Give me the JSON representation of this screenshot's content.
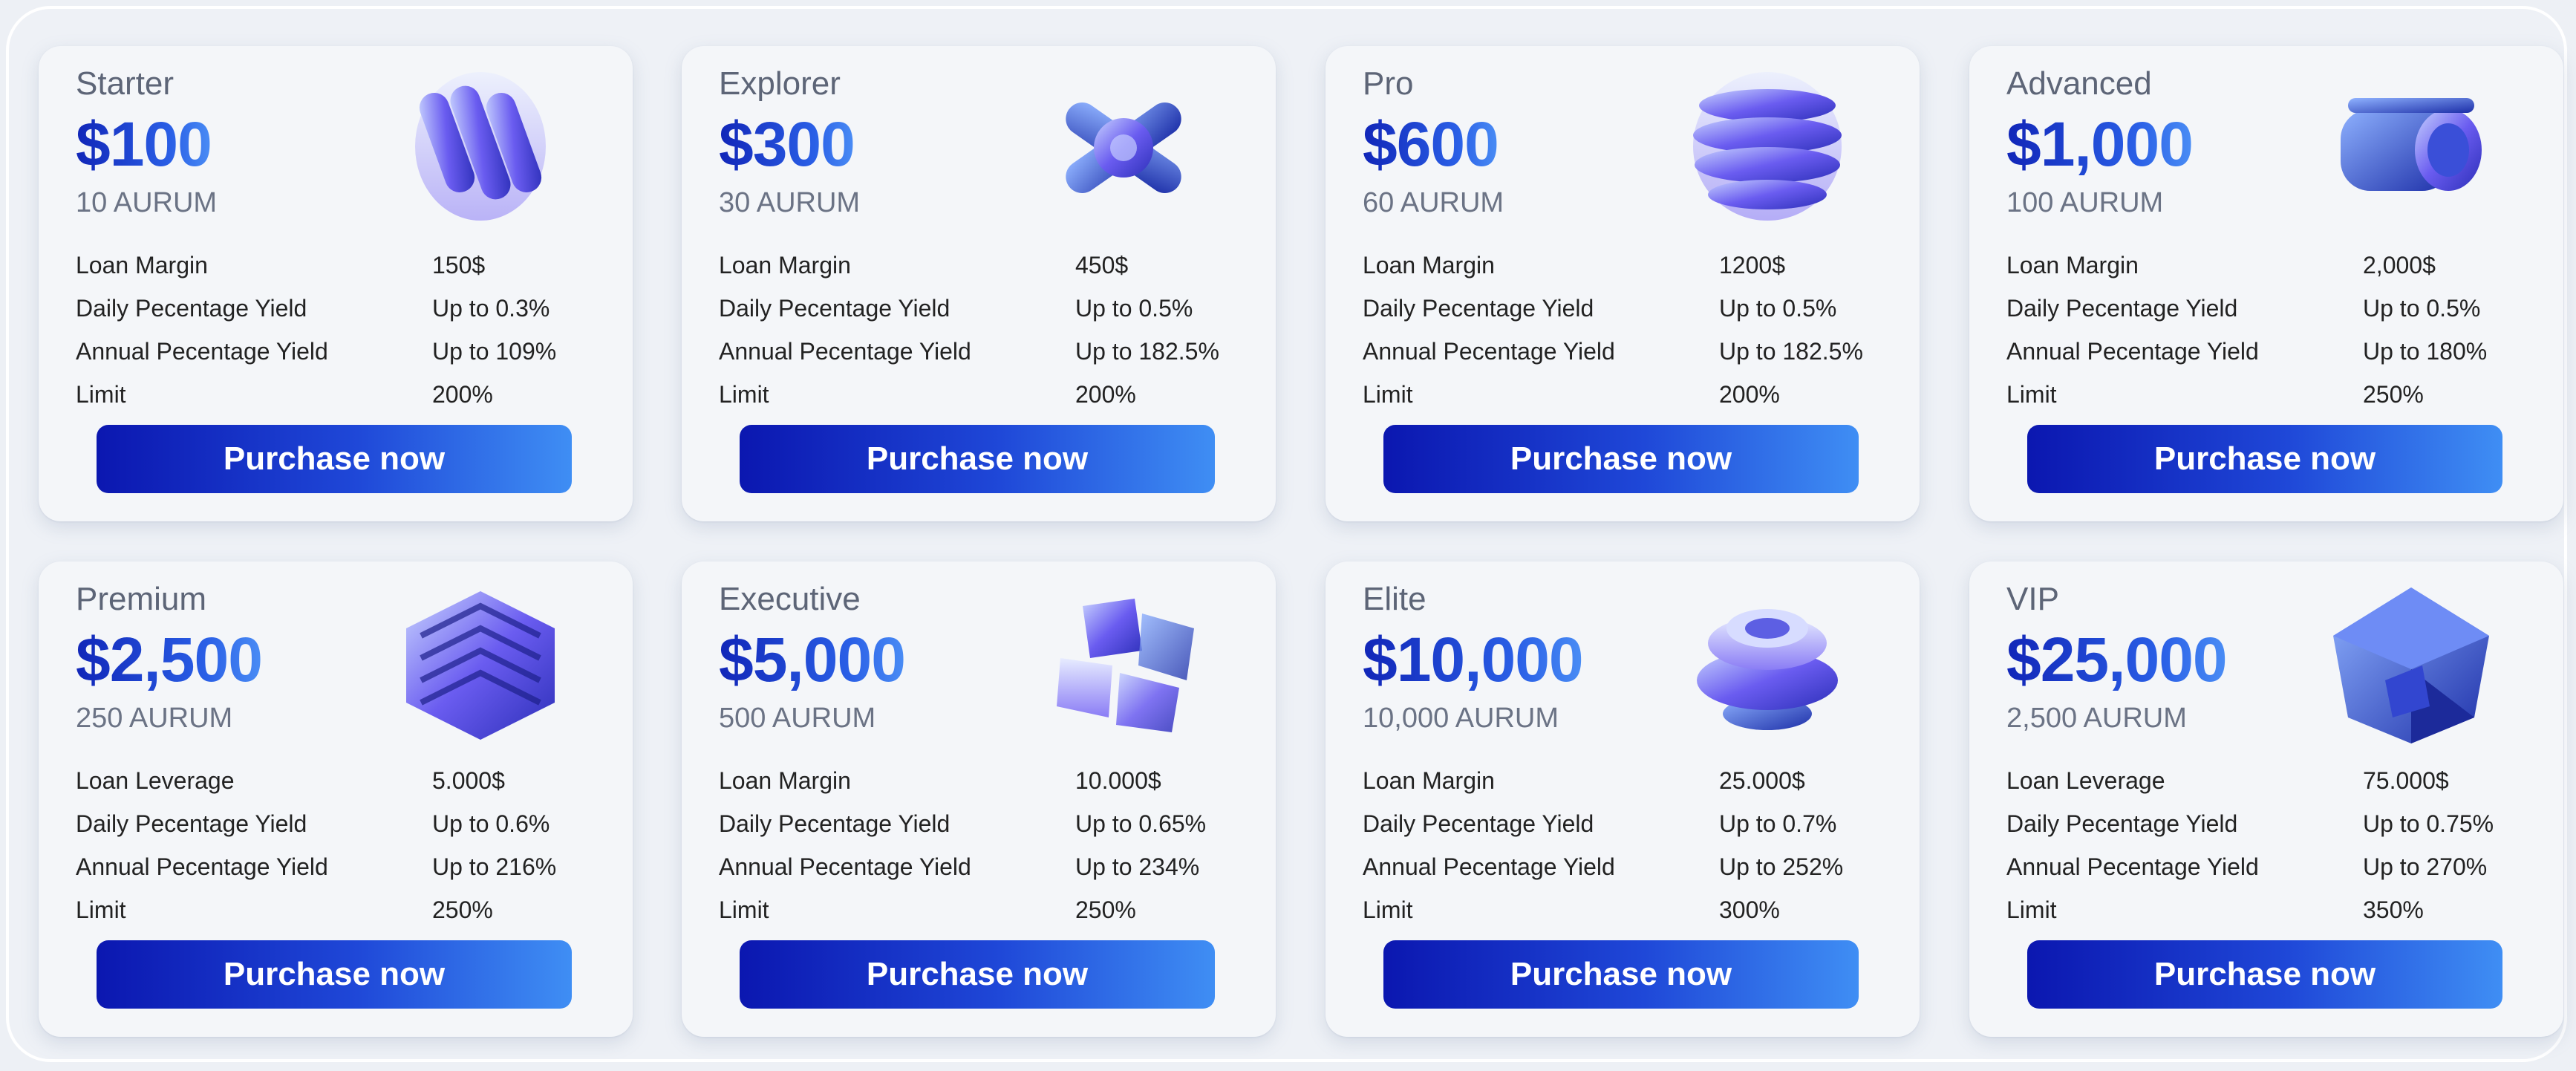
{
  "cards": [
    {
      "tier": "Starter",
      "price": "$100",
      "aurum": "10 AURUM",
      "rows": [
        {
          "k": "Loan Margin",
          "v": "150$"
        },
        {
          "k": "Daily Pecentage Yield",
          "v": "Up to 0.3%"
        },
        {
          "k": "Annual Pecentage Yield",
          "v": "Up to 109%"
        },
        {
          "k": "Limit",
          "v": "200%"
        }
      ],
      "button": "Purchase now",
      "art": "stacked-rings-icon"
    },
    {
      "tier": "Explorer",
      "price": "$300",
      "aurum": "30 AURUM",
      "rows": [
        {
          "k": "Loan Margin",
          "v": "450$"
        },
        {
          "k": "Daily Pecentage Yield",
          "v": "Up to 0.5%"
        },
        {
          "k": "Annual Pecentage Yield",
          "v": "Up to 182.5%"
        },
        {
          "k": "Limit",
          "v": "200%"
        }
      ],
      "button": "Purchase now",
      "art": "cross-connector-icon"
    },
    {
      "tier": "Pro",
      "price": "$600",
      "aurum": "60 AURUM",
      "rows": [
        {
          "k": "Loan Margin",
          "v": "1200$"
        },
        {
          "k": "Daily Pecentage Yield",
          "v": "Up to 0.5%"
        },
        {
          "k": "Annual Pecentage Yield",
          "v": "Up to 182.5%"
        },
        {
          "k": "Limit",
          "v": "200%"
        }
      ],
      "button": "Purchase now",
      "art": "spiral-sphere-icon"
    },
    {
      "tier": "Advanced",
      "price": "$1,000",
      "aurum": "100 AURUM",
      "rows": [
        {
          "k": "Loan Margin",
          "v": "2,000$"
        },
        {
          "k": "Daily Pecentage Yield",
          "v": "Up to 0.5%"
        },
        {
          "k": "Annual Pecentage Yield",
          "v": "Up to 180%"
        },
        {
          "k": "Limit",
          "v": "250%"
        }
      ],
      "button": "Purchase now",
      "art": "cylinder-icon"
    },
    {
      "tier": "Premium",
      "price": "$2,500",
      "aurum": "250 AURUM",
      "rows": [
        {
          "k": "Loan Leverage",
          "v": "5.000$"
        },
        {
          "k": "Daily Pecentage Yield",
          "v": "Up to 0.6%"
        },
        {
          "k": "Annual Pecentage Yield",
          "v": "Up to 216%"
        },
        {
          "k": "Limit",
          "v": "250%"
        }
      ],
      "button": "Purchase now",
      "art": "maze-cube-icon"
    },
    {
      "tier": "Executive",
      "price": "$5,000",
      "aurum": "500 AURUM",
      "rows": [
        {
          "k": "Loan Margin",
          "v": "10.000$"
        },
        {
          "k": "Daily Pecentage Yield",
          "v": "Up to 0.65%"
        },
        {
          "k": "Annual Pecentage Yield",
          "v": "Up to 234%"
        },
        {
          "k": "Limit",
          "v": "250%"
        }
      ],
      "button": "Purchase now",
      "art": "shattered-cube-icon"
    },
    {
      "tier": "Elite",
      "price": "$10,000",
      "aurum": "10,000 AURUM",
      "rows": [
        {
          "k": "Loan Margin",
          "v": "25.000$"
        },
        {
          "k": "Daily Pecentage Yield",
          "v": "Up to 0.7%"
        },
        {
          "k": "Annual Pecentage Yield",
          "v": "Up to 252%"
        },
        {
          "k": "Limit",
          "v": "300%"
        }
      ],
      "button": "Purchase now",
      "art": "disc-stack-icon"
    },
    {
      "tier": "VIP",
      "price": "$25,000",
      "aurum": "2,500 AURUM",
      "rows": [
        {
          "k": "Loan Leverage",
          "v": "75.000$"
        },
        {
          "k": "Daily Pecentage Yield",
          "v": "Up to 0.75%"
        },
        {
          "k": "Annual Pecentage Yield",
          "v": "Up to 270%"
        },
        {
          "k": "Limit",
          "v": "350%"
        }
      ],
      "button": "Purchase now",
      "art": "faceted-cube-icon"
    }
  ],
  "colors": {
    "accent": "#1d33c8",
    "button_start": "#0b17b0",
    "button_end": "#3f8ef4",
    "card_bg": "#f4f6f9",
    "page_bg": "#edf0f5"
  }
}
